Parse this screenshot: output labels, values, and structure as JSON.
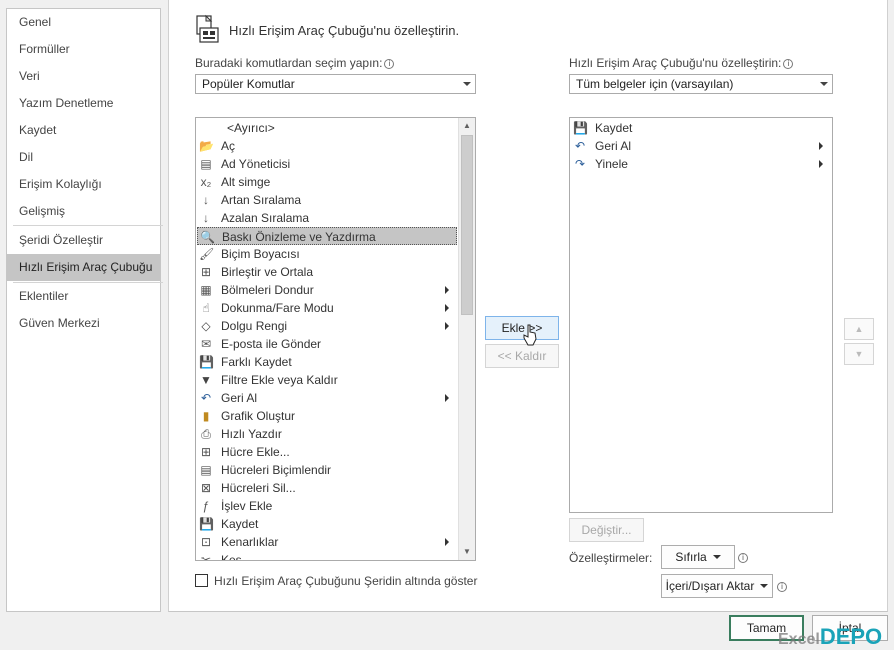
{
  "nav": {
    "items": [
      "Genel",
      "Formüller",
      "Veri",
      "Yazım Denetleme",
      "Kaydet",
      "Dil",
      "Erişim Kolaylığı",
      "Gelişmiş",
      "Şeridi Özelleştir",
      "Hızlı Erişim Araç Çubuğu",
      "Eklentiler",
      "Güven Merkezi"
    ],
    "selected": "Hızlı Erişim Araç Çubuğu"
  },
  "header": {
    "title": "Hızlı Erişim Araç Çubuğu'nu özelleştirin."
  },
  "left": {
    "label": "Buradaki komutlardan seçim yapın:",
    "dropdown_value": "Popüler Komutlar",
    "commands": [
      {
        "label": "<Ayırıcı>",
        "icon": "separator-icon",
        "submenu": false
      },
      {
        "label": "Aç",
        "icon": "folder-open-icon",
        "submenu": false
      },
      {
        "label": "Ad Yöneticisi",
        "icon": "name-manager-icon",
        "submenu": false
      },
      {
        "label": "Alt simge",
        "icon": "subscript-icon",
        "submenu": false
      },
      {
        "label": "Artan Sıralama",
        "icon": "sort-ascending-icon",
        "submenu": false
      },
      {
        "label": "Azalan Sıralama",
        "icon": "sort-descending-icon",
        "submenu": false
      },
      {
        "label": "Baskı Önizleme ve Yazdırma",
        "icon": "print-preview-icon",
        "submenu": false,
        "selected": true
      },
      {
        "label": "Biçim Boyacısı",
        "icon": "format-painter-icon",
        "submenu": false
      },
      {
        "label": "Birleştir ve Ortala",
        "icon": "merge-center-icon",
        "submenu": false
      },
      {
        "label": "Bölmeleri Dondur",
        "icon": "freeze-panes-icon",
        "submenu": true
      },
      {
        "label": "Dokunma/Fare Modu",
        "icon": "touch-mode-icon",
        "submenu": true
      },
      {
        "label": "Dolgu Rengi",
        "icon": "fill-color-icon",
        "submenu": true
      },
      {
        "label": "E-posta ile Gönder",
        "icon": "email-icon",
        "submenu": false
      },
      {
        "label": "Farklı Kaydet",
        "icon": "save-as-icon",
        "submenu": false
      },
      {
        "label": "Filtre Ekle veya Kaldır",
        "icon": "filter-icon",
        "submenu": false
      },
      {
        "label": "Geri Al",
        "icon": "undo-icon",
        "submenu": true
      },
      {
        "label": "Grafik Oluştur",
        "icon": "chart-icon",
        "submenu": false
      },
      {
        "label": "Hızlı Yazdır",
        "icon": "quick-print-icon",
        "submenu": false
      },
      {
        "label": "Hücre Ekle...",
        "icon": "insert-cells-icon",
        "submenu": false
      },
      {
        "label": "Hücreleri Biçimlendir",
        "icon": "format-cells-icon",
        "submenu": false
      },
      {
        "label": "Hücreleri Sil...",
        "icon": "delete-cells-icon",
        "submenu": false
      },
      {
        "label": "İşlev Ekle",
        "icon": "insert-function-icon",
        "submenu": false
      },
      {
        "label": "Kaydet",
        "icon": "save-icon",
        "submenu": false
      },
      {
        "label": "Kenarlıklar",
        "icon": "borders-icon",
        "submenu": true
      },
      {
        "label": "Kes",
        "icon": "cut-icon",
        "submenu": false
      }
    ],
    "checkbox_label": "Hızlı Erişim Araç Çubuğunu Şeridin altında göster"
  },
  "right": {
    "label": "Hızlı Erişim Araç Çubuğu'nu özelleştirin:",
    "dropdown_value": "Tüm belgeler için (varsayılan)",
    "items": [
      {
        "label": "Kaydet",
        "icon": "save-icon",
        "submenu": false
      },
      {
        "label": "Geri Al",
        "icon": "undo-icon",
        "submenu": true
      },
      {
        "label": "Yinele",
        "icon": "redo-icon",
        "submenu": true
      }
    ],
    "modify_button": "Değiştir...",
    "customizations_label": "Özelleştirmeler:",
    "reset_button": "Sıfırla",
    "import_export_button": "İçeri/Dışarı Aktar"
  },
  "buttons": {
    "add": "Ekle >>",
    "remove": "<< Kaldır",
    "ok": "Tamam",
    "cancel": "İptal"
  },
  "watermark": {
    "part1": "Excel",
    "part2": "DEPO"
  },
  "colors": {
    "selected_bg": "#c5c5c5",
    "add_button_bg": "#e5f1fb",
    "ok_border": "#3a7d5e",
    "watermark": "#1aa3b8"
  }
}
